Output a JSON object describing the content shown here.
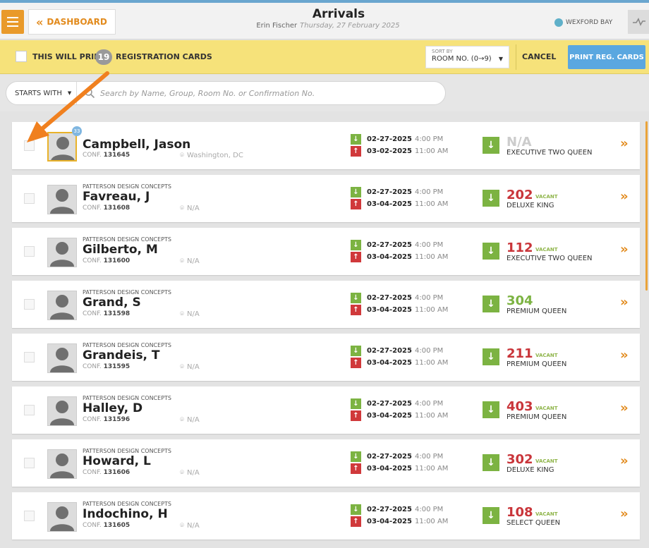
{
  "header": {
    "back_label": "DASHBOARD",
    "title": "Arrivals",
    "user": "Erin Fischer",
    "date": "Thursday, 27 February 2025",
    "brand": "WEXFORD BAY"
  },
  "print_bar": {
    "text_before": "THIS WILL PRINT",
    "count": "19",
    "text_after": "REGISTRATION CARDS",
    "sort_label": "SORT BY",
    "sort_value": "ROOM NO. (0→9)",
    "cancel_label": "CANCEL",
    "print_label": "PRINT REG. CARDS"
  },
  "search": {
    "filter_label": "STARTS WITH",
    "placeholder": "Search by Name, Group, Room No. or Confirmation No."
  },
  "reservations": [
    {
      "company": "",
      "name": "Campbell, Jason",
      "conf": "131645",
      "location": "Washington, DC",
      "arrive_date": "02-27-2025",
      "arrive_time": "4:00 PM",
      "depart_date": "03-02-2025",
      "depart_time": "11:00 AM",
      "room": "N/A",
      "vacant": "",
      "room_type": "EXECUTIVE TWO QUEEN",
      "badge": "33"
    },
    {
      "company": "PATTERSON DESIGN CONCEPTS",
      "name": "Favreau, J",
      "conf": "131608",
      "location": "N/A",
      "arrive_date": "02-27-2025",
      "arrive_time": "4:00 PM",
      "depart_date": "03-04-2025",
      "depart_time": "11:00 AM",
      "room": "202",
      "vacant": "VACANT",
      "room_type": "DELUXE KING"
    },
    {
      "company": "PATTERSON DESIGN CONCEPTS",
      "name": "Gilberto, M",
      "conf": "131600",
      "location": "N/A",
      "arrive_date": "02-27-2025",
      "arrive_time": "4:00 PM",
      "depart_date": "03-04-2025",
      "depart_time": "11:00 AM",
      "room": "112",
      "vacant": "VACANT",
      "room_type": "EXECUTIVE TWO QUEEN"
    },
    {
      "company": "PATTERSON DESIGN CONCEPTS",
      "name": "Grand, S",
      "conf": "131598",
      "location": "N/A",
      "arrive_date": "02-27-2025",
      "arrive_time": "4:00 PM",
      "depart_date": "03-04-2025",
      "depart_time": "11:00 AM",
      "room": "304",
      "vacant": "",
      "room_type": "PREMIUM QUEEN"
    },
    {
      "company": "PATTERSON DESIGN CONCEPTS",
      "name": "Grandeis, T",
      "conf": "131595",
      "location": "N/A",
      "arrive_date": "02-27-2025",
      "arrive_time": "4:00 PM",
      "depart_date": "03-04-2025",
      "depart_time": "11:00 AM",
      "room": "211",
      "vacant": "VACANT",
      "room_type": "PREMIUM QUEEN"
    },
    {
      "company": "PATTERSON DESIGN CONCEPTS",
      "name": "Halley, D",
      "conf": "131596",
      "location": "N/A",
      "arrive_date": "02-27-2025",
      "arrive_time": "4:00 PM",
      "depart_date": "03-04-2025",
      "depart_time": "11:00 AM",
      "room": "403",
      "vacant": "VACANT",
      "room_type": "PREMIUM QUEEN"
    },
    {
      "company": "PATTERSON DESIGN CONCEPTS",
      "name": "Howard, L",
      "conf": "131606",
      "location": "N/A",
      "arrive_date": "02-27-2025",
      "arrive_time": "4:00 PM",
      "depart_date": "03-04-2025",
      "depart_time": "11:00 AM",
      "room": "302",
      "vacant": "VACANT",
      "room_type": "DELUXE KING"
    },
    {
      "company": "PATTERSON DESIGN CONCEPTS",
      "name": "Indochino, H",
      "conf": "131605",
      "location": "N/A",
      "arrive_date": "02-27-2025",
      "arrive_time": "4:00 PM",
      "depart_date": "03-04-2025",
      "depart_time": "11:00 AM",
      "room": "108",
      "vacant": "VACANT",
      "room_type": "SELECT QUEEN"
    }
  ],
  "labels": {
    "conf_prefix": "CONF."
  },
  "colors": {
    "accent": "#e28b1e",
    "print_bar": "#f6e27a",
    "print_button": "#5aa7e0",
    "vacant_red": "#c9353a",
    "arrive_green": "#7cb342",
    "depart_red": "#d0393b"
  }
}
